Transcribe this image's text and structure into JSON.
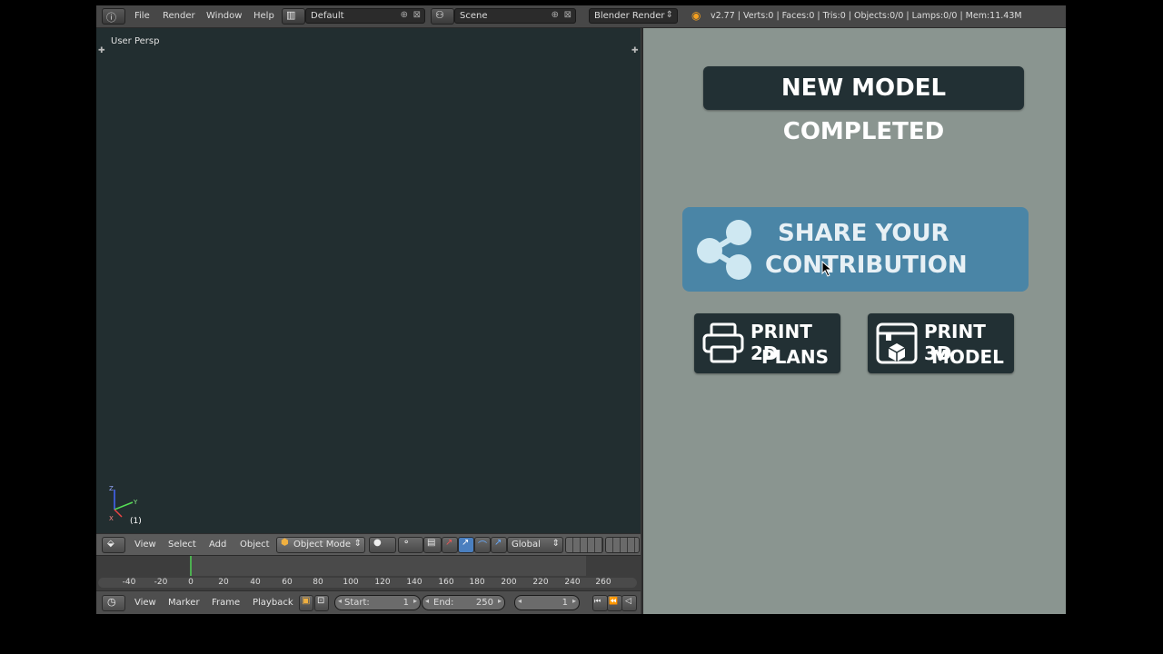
{
  "topbar": {
    "menus": [
      "File",
      "Render",
      "Window",
      "Help"
    ],
    "layout_value": "Default",
    "scene_value": "Scene",
    "render_engine": "Blender Render",
    "stats": "v2.77 | Verts:0 | Faces:0 | Tris:0 | Objects:0/0 | Lamps:0/0 | Mem:11.43M"
  },
  "viewport": {
    "label": "User Persp",
    "object_index": "(1)",
    "axis_labels": {
      "z": "Z",
      "x": "X",
      "y": "Y"
    }
  },
  "view3d_header": {
    "menus": [
      "View",
      "Select",
      "Add",
      "Object"
    ],
    "mode": "Object Mode",
    "orientation": "Global"
  },
  "timeline": {
    "ticks": [
      "-40",
      "-20",
      "0",
      "20",
      "40",
      "60",
      "80",
      "100",
      "120",
      "140",
      "160",
      "180",
      "200",
      "220",
      "240",
      "260"
    ]
  },
  "timeline_header": {
    "menus": [
      "View",
      "Marker",
      "Frame",
      "Playback"
    ],
    "start_label": "Start:",
    "start_value": "1",
    "end_label": "End:",
    "end_value": "250",
    "current_frame": "1"
  },
  "panel": {
    "banner": "NEW MODEL COMPLETED",
    "share_line1": "SHARE YOUR",
    "share_line2": "CONTRIBUTION",
    "print2d_line1": "PRINT 2D",
    "print2d_line2": "PLANS",
    "print3d_line1": "PRINT 3D",
    "print3d_line2": "MODEL"
  },
  "colors": {
    "viewport_bg": "#222e30",
    "panel_bg": "#8a9590",
    "share_bg": "#4a85a6",
    "banner_bg": "#223034",
    "timeline_marker": "#4caf50"
  }
}
